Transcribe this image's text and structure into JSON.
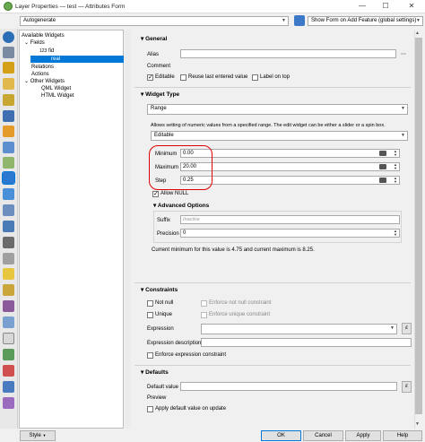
{
  "window": {
    "title": "Layer Properties — test — Attributes Form",
    "minimize": "—",
    "maximize": "☐",
    "close": "✕"
  },
  "toolbar": {
    "mode_value": "Autogenerate",
    "show_form_value": "Show Form on Add Feature (global settings)"
  },
  "tree": {
    "available": "Available Widgets",
    "fields": "Fields",
    "fid_type": "123",
    "fid": "fid",
    "real": "real",
    "relations": "Relations",
    "actions": "Actions",
    "other": "Other Widgets",
    "qml": "QML Widget",
    "html": "HTML Widget"
  },
  "general": {
    "header": "General",
    "alias_label": "Alias",
    "comment_label": "Comment",
    "editable_label": "Editable",
    "reuse_label": "Reuse last entered value",
    "label_on_top": "Label on top"
  },
  "widget_type": {
    "header": "Widget Type",
    "type_value": "Range",
    "description": "Allows setting of numeric values from a specified range. The edit widget can be either a slider or a spin box.",
    "editable_value": "Editable",
    "minimum_label": "Minimum",
    "minimum_value": "0.00",
    "maximum_label": "Maximum",
    "maximum_value": "20.00",
    "step_label": "Step",
    "step_value": "0.25",
    "allow_null": "Allow NULL",
    "advanced_header": "Advanced Options",
    "suffix_label": "Suffix",
    "suffix_placeholder": "Inactive",
    "precision_label": "Precision",
    "precision_value": "0",
    "current_info": "Current minimum for this value is 4.75 and current maximum is 8.25."
  },
  "constraints": {
    "header": "Constraints",
    "not_null": "Not null",
    "enforce_not_null": "Enforce not null constraint",
    "unique": "Unique",
    "enforce_unique": "Enforce unique constraint",
    "expression_label": "Expression",
    "expression_desc_label": "Expression description",
    "enforce_expr": "Enforce expression constraint",
    "epsilon": "ε"
  },
  "defaults": {
    "header": "Defaults",
    "default_label": "Default value",
    "preview_label": "Preview",
    "apply_update": "Apply default value on update",
    "epsilon": "ε"
  },
  "bottom": {
    "style": "Style",
    "ok": "OK",
    "cancel": "Cancel",
    "apply": "Apply",
    "help": "Help"
  },
  "colors": {
    "selection": "#0078d7",
    "red_annotation": "#e00000"
  }
}
